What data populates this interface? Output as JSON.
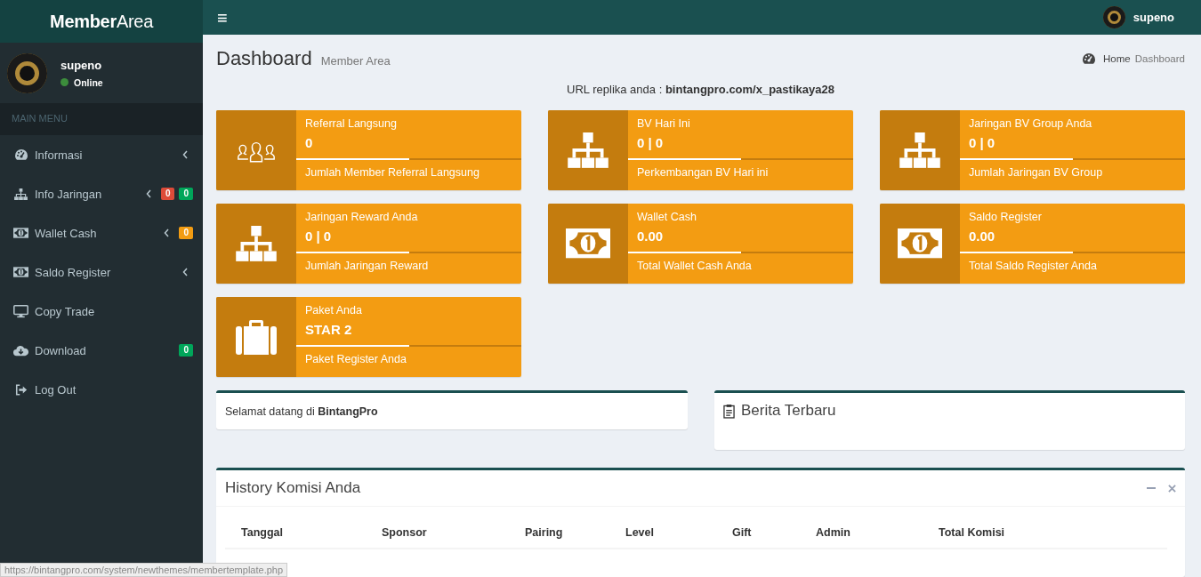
{
  "brand": {
    "text_bold": "Member",
    "text_light": "Area"
  },
  "user": {
    "name": "supeno",
    "status": "Online"
  },
  "sidebar": {
    "header": "MAIN MENU",
    "items": [
      {
        "kind": "dashboard",
        "label": "Informasi",
        "expandable": true
      },
      {
        "kind": "sitemap",
        "label": "Info Jaringan",
        "expandable": true,
        "badges": [
          {
            "text": "0",
            "color": "#dd4b39"
          },
          {
            "text": "0",
            "color": "#00a65a"
          }
        ]
      },
      {
        "kind": "money",
        "label": "Wallet Cash",
        "expandable": true,
        "badges": [
          {
            "text": "0",
            "color": "#f39c12"
          }
        ]
      },
      {
        "kind": "money",
        "label": "Saldo Register",
        "expandable": true
      },
      {
        "kind": "desktop",
        "label": "Copy Trade",
        "expandable": false
      },
      {
        "kind": "download",
        "label": "Download",
        "expandable": false,
        "badges": [
          {
            "text": "0",
            "color": "#00a65a"
          }
        ]
      },
      {
        "kind": "logout",
        "label": "Log Out",
        "expandable": false
      }
    ]
  },
  "topbar": {
    "menu_glyph": "≡",
    "user": "supeno"
  },
  "page": {
    "title": "Dashboard",
    "subtitle": "Member Area",
    "breadcrumb": [
      {
        "label": "Home"
      },
      {
        "label": "Dashboard"
      }
    ]
  },
  "url_line": "URL replika anda : **bintangpro.com/x_pastikaya28**",
  "cards": [
    {
      "kind": "users",
      "title": "Referral Langsung",
      "value": "0",
      "level": 0.5,
      "description": "Jumlah Member Referral Langsung"
    },
    {
      "kind": "sitemap",
      "title": "BV Hari Ini",
      "value": "0 | 0",
      "level": 0.5,
      "description": "Perkembangan BV Hari ini"
    },
    {
      "kind": "sitemap",
      "title": "Jaringan BV Group Anda",
      "value": "0 | 0",
      "level": 0.5,
      "description": "Jumlah Jaringan BV Group"
    },
    {
      "kind": "sitemap",
      "title": "Jaringan Reward Anda",
      "value": "0 | 0",
      "level": 0.5,
      "description": "Jumlah Jaringan Reward"
    },
    {
      "kind": "money",
      "title": "Wallet Cash",
      "value": "0.00",
      "level": 0.5,
      "description": "Total Wallet Cash Anda"
    },
    {
      "kind": "money",
      "title": "Saldo Register",
      "value": "0.00",
      "level": 0.5,
      "description": "Total Saldo Register Anda"
    },
    {
      "kind": "briefcase",
      "title": "Paket Anda",
      "value": "STAR 2",
      "level": 0.5,
      "description": "Paket Register Anda"
    }
  ],
  "welcome": "Selamat datang di **BintangPro**",
  "news": {
    "title": "Berita Terbaru"
  },
  "history": {
    "title": "History Komisi Anda",
    "columns": [
      "Tanggal",
      "Sponsor",
      "Pairing",
      "Level",
      "Gift",
      "Admin",
      "Total Komisi"
    ]
  },
  "status_bar": "https://bintangpro.com/system/newthemes/membertemplate.php"
}
